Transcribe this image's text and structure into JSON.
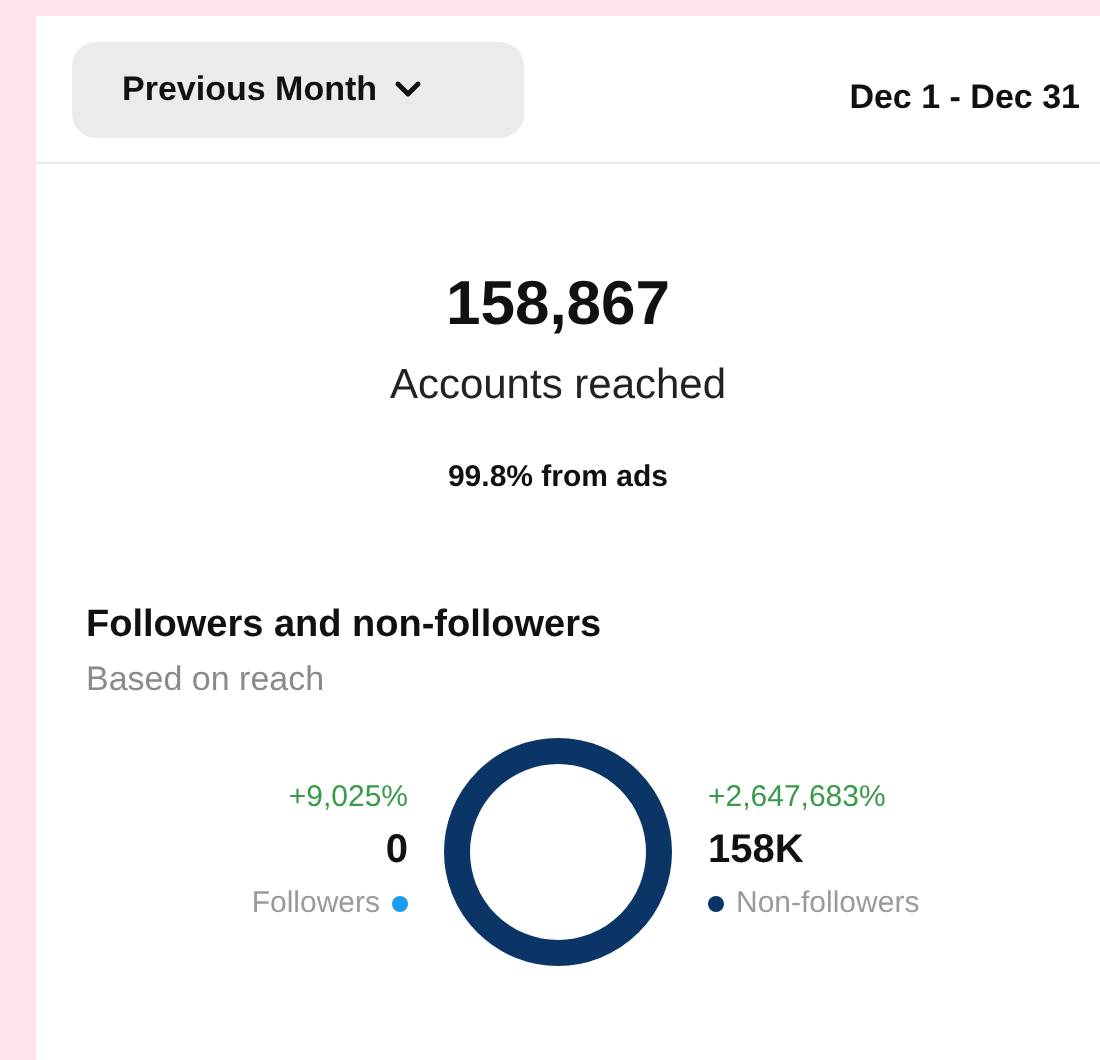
{
  "header": {
    "period_button": "Previous Month",
    "date_range": "Dec 1 - Dec 31"
  },
  "summary": {
    "value": "158,867",
    "label": "Accounts reached",
    "note": "99.8% from ads"
  },
  "section": {
    "title": "Followers and non-followers",
    "subtitle": "Based on reach"
  },
  "legend": [
    {
      "change": "+9,025%",
      "value": "0",
      "label": "Followers",
      "color": "#1a9bf0"
    },
    {
      "change": "+2,647,683%",
      "value": "158K",
      "label": "Non-followers",
      "color": "#0a3566"
    }
  ]
}
